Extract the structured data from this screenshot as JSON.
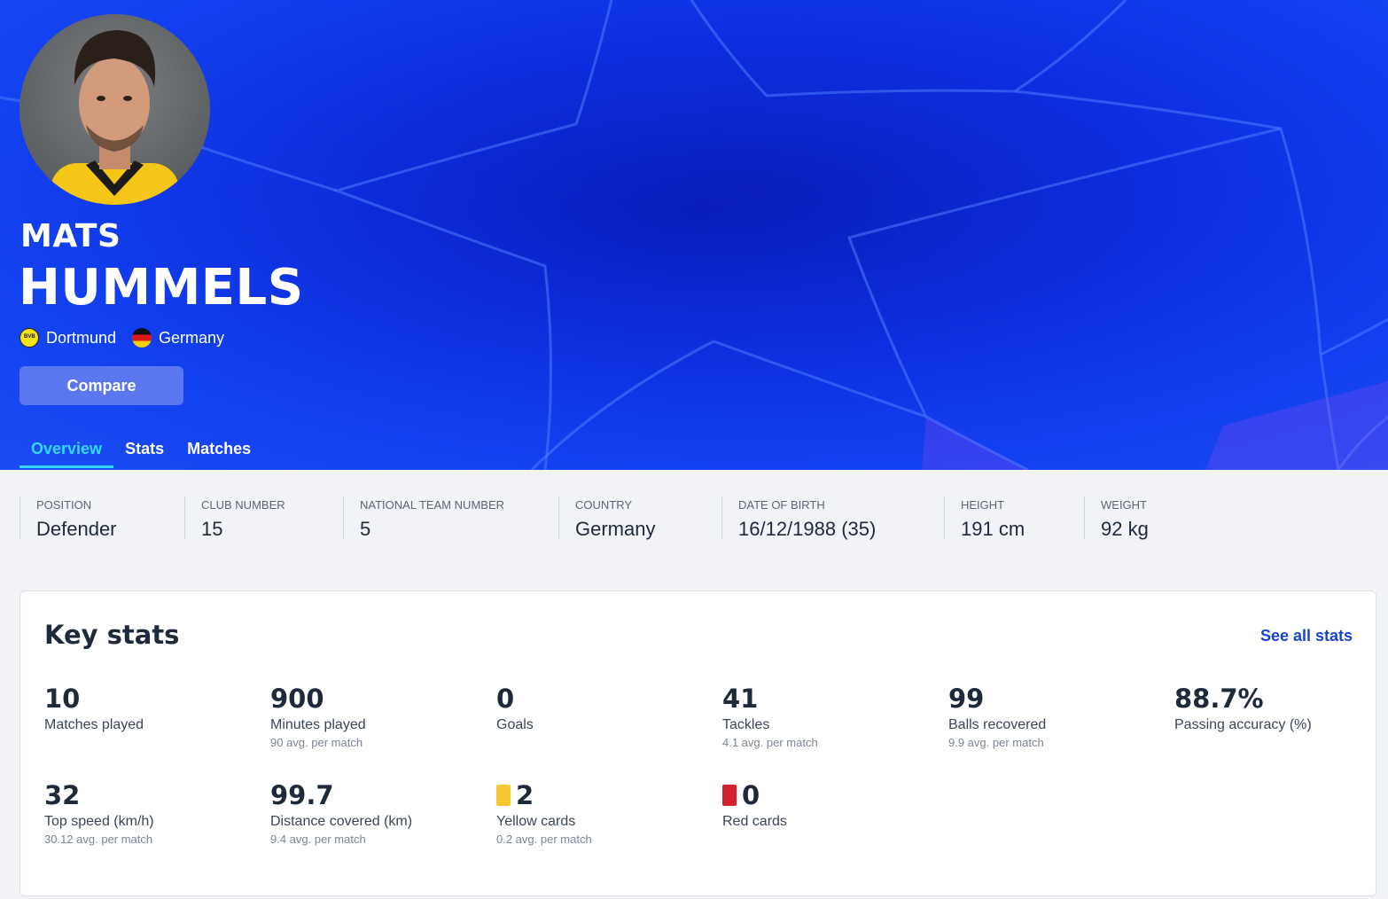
{
  "player": {
    "first_name": "MATS",
    "last_name": "HUMMELS",
    "club": "Dortmund",
    "club_icon": "dortmund-crest-icon",
    "country": "Germany",
    "country_icon": "germany-flag-icon",
    "compare_label": "Compare",
    "hero_colors": {
      "background": "#0b2ae0",
      "tab_active": "#35d6ff",
      "button": "#5a77f0"
    }
  },
  "tabs": [
    {
      "label": "Overview",
      "active": true
    },
    {
      "label": "Stats",
      "active": false
    },
    {
      "label": "Matches",
      "active": false
    }
  ],
  "info": [
    {
      "label": "POSITION",
      "value": "Defender"
    },
    {
      "label": "CLUB NUMBER",
      "value": "15"
    },
    {
      "label": "NATIONAL TEAM NUMBER",
      "value": "5"
    },
    {
      "label": "COUNTRY",
      "value": "Germany"
    },
    {
      "label": "DATE OF BIRTH",
      "value": "16/12/1988 (35)"
    },
    {
      "label": "HEIGHT",
      "value": "191 cm"
    },
    {
      "label": "WEIGHT",
      "value": "92 kg"
    }
  ],
  "key_stats": {
    "title": "Key stats",
    "see_all": "See all stats",
    "items": [
      {
        "value": "10",
        "label": "Matches played",
        "sub": ""
      },
      {
        "value": "900",
        "label": "Minutes played",
        "sub": "90 avg. per match"
      },
      {
        "value": "0",
        "label": "Goals",
        "sub": ""
      },
      {
        "value": "41",
        "label": "Tackles",
        "sub": "4.1 avg. per match"
      },
      {
        "value": "99",
        "label": "Balls recovered",
        "sub": "9.9 avg. per match"
      },
      {
        "value": "88.7%",
        "label": "Passing accuracy (%)",
        "sub": ""
      },
      {
        "value": "32",
        "label": "Top speed (km/h)",
        "sub": "30.12 avg. per match"
      },
      {
        "value": "99.7",
        "label": "Distance covered (km)",
        "sub": "9.4 avg. per match"
      },
      {
        "value": "2",
        "label": "Yellow cards",
        "sub": "0.2 avg. per match",
        "icon": "yellow-card-icon",
        "icon_color": "#f8c832"
      },
      {
        "value": "0",
        "label": "Red cards",
        "sub": "",
        "icon": "red-card-icon",
        "icon_color": "#d4212c"
      }
    ]
  }
}
